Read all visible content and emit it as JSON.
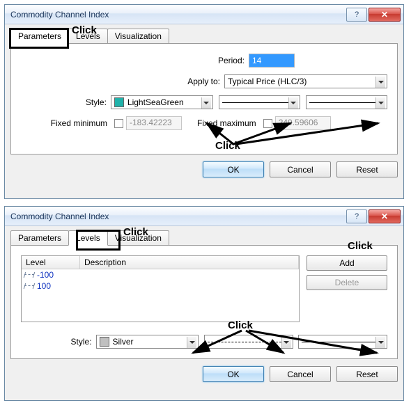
{
  "dialog1": {
    "title": "Commodity Channel Index",
    "tabs": {
      "parameters": "Parameters",
      "levels": "Levels",
      "visualization": "Visualization"
    },
    "labels": {
      "period": "Period:",
      "apply_to": "Apply to:",
      "style": "Style:",
      "fixed_min": "Fixed minimum",
      "fixed_max": "Fixed maximum"
    },
    "values": {
      "period": "14",
      "apply_to": "Typical Price (HLC/3)",
      "style_color_name": "LightSeaGreen",
      "style_color_hex": "#20B2AA",
      "fixed_min": "-183.42223",
      "fixed_max": "249.59606"
    },
    "buttons": {
      "ok": "OK",
      "cancel": "Cancel",
      "reset": "Reset"
    },
    "annotations": {
      "click_top": "Click",
      "click_mid": "Click"
    }
  },
  "dialog2": {
    "title": "Commodity Channel Index",
    "tabs": {
      "parameters": "Parameters",
      "levels": "Levels",
      "visualization": "Visualization"
    },
    "table": {
      "headers": {
        "level": "Level",
        "description": "Description"
      },
      "rows": [
        {
          "level": "-100",
          "description": ""
        },
        {
          "level": "100",
          "description": ""
        }
      ]
    },
    "side_buttons": {
      "add": "Add",
      "delete": "Delete"
    },
    "labels": {
      "style": "Style:"
    },
    "values": {
      "style_color_name": "Silver",
      "style_color_hex": "#C0C0C0"
    },
    "buttons": {
      "ok": "OK",
      "cancel": "Cancel",
      "reset": "Reset"
    },
    "annotations": {
      "click_top": "Click",
      "click_right": "Click",
      "click_mid": "Click"
    }
  }
}
